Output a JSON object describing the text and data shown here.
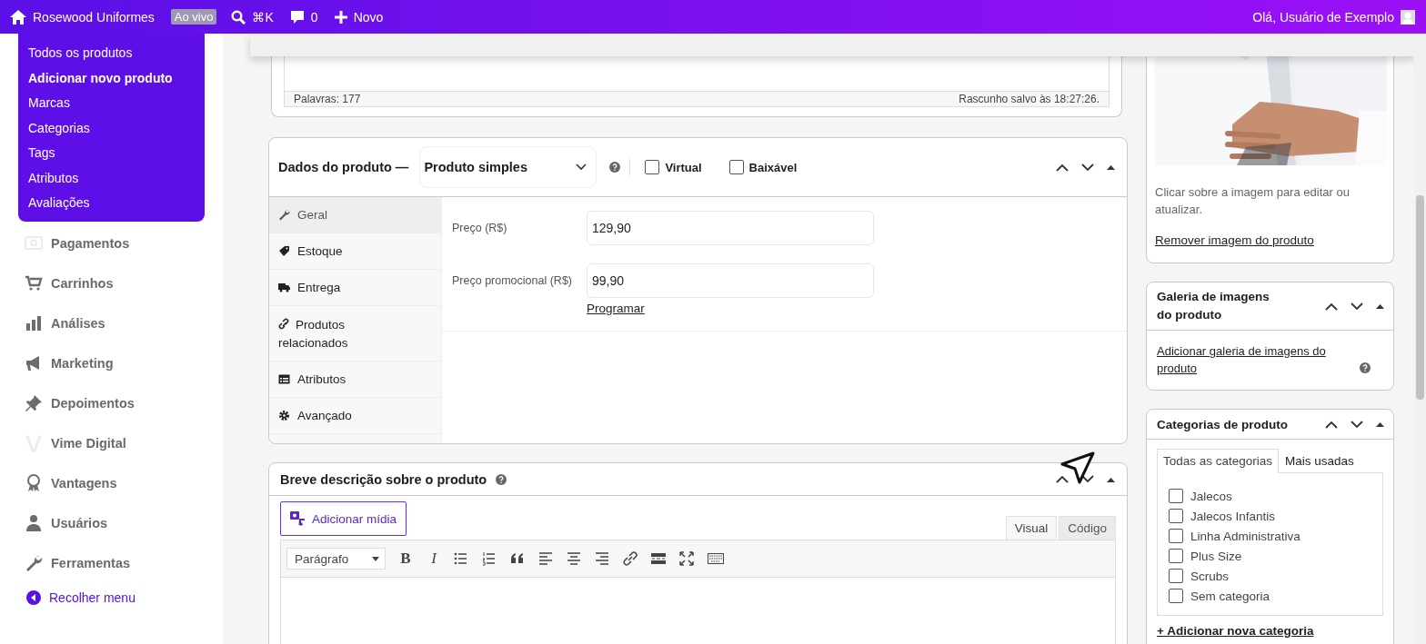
{
  "topbar": {
    "site_name": "Rosewood Uniformes",
    "badge": "Ao vivo",
    "search_shortcut": "⌘K",
    "comments": "0",
    "new_label": "Novo",
    "greeting": "Olá, Usuário de Exemplo"
  },
  "sidebar": {
    "submenu": [
      {
        "label": "Todos os produtos",
        "selected": false
      },
      {
        "label": "Adicionar novo produto",
        "selected": true
      },
      {
        "label": "Marcas",
        "selected": false
      },
      {
        "label": "Categorias",
        "selected": false
      },
      {
        "label": "Tags",
        "selected": false
      },
      {
        "label": "Atributos",
        "selected": false
      },
      {
        "label": "Avaliações",
        "selected": false
      }
    ],
    "items": [
      {
        "label": "Pagamentos"
      },
      {
        "label": "Carrinhos"
      },
      {
        "label": "Análises"
      },
      {
        "label": "Marketing"
      },
      {
        "label": "Depoimentos"
      },
      {
        "label": "Vime Digital"
      },
      {
        "label": "Vantagens"
      },
      {
        "label": "Usuários"
      },
      {
        "label": "Ferramentas"
      }
    ],
    "collapse": "Recolher menu"
  },
  "editor": {
    "word_count": "Palavras: 177",
    "draft_status": "Rascunho salvo às 18:27:26."
  },
  "product_data": {
    "title": "Dados do produto —",
    "type_select": "Produto simples",
    "options": [
      {
        "label": "Virtual",
        "checked": false
      },
      {
        "label": "Baixável",
        "checked": false
      }
    ],
    "tabs": [
      {
        "label": "Geral",
        "selected": true
      },
      {
        "label": "Estoque",
        "selected": false
      },
      {
        "label": "Entrega",
        "selected": false
      },
      {
        "label": "Produtos relacionados",
        "selected": false
      },
      {
        "label": "Atributos",
        "selected": false
      },
      {
        "label": "Avançado",
        "selected": false
      }
    ],
    "fields": [
      {
        "label": "Preço (R$)",
        "value": "129,90"
      },
      {
        "label": "Preço promocional (R$)",
        "value": "99,90"
      }
    ],
    "schedule_link": "Programar"
  },
  "short_description": {
    "title": "Breve descrição sobre o produto",
    "add_media": "Adicionar mídia",
    "editor_tabs": [
      {
        "label": "Visual",
        "selected": true
      },
      {
        "label": "Código",
        "selected": false
      }
    ],
    "format_select": "Parágrafo",
    "toolbar": [
      {
        "kind": "bold",
        "label": "B"
      },
      {
        "kind": "italic",
        "label": "I"
      },
      {
        "kind": "bullet-list"
      },
      {
        "kind": "numbered-list"
      },
      {
        "kind": "quote"
      },
      {
        "kind": "align-left"
      },
      {
        "kind": "align-center"
      },
      {
        "kind": "align-right"
      },
      {
        "kind": "link"
      },
      {
        "kind": "more"
      },
      {
        "kind": "fullscreen"
      },
      {
        "kind": "keyboard"
      }
    ]
  },
  "product_image": {
    "kind": "picture",
    "hint": "Clicar sobre a imagem para editar ou atualizar.",
    "remove_link": "Remover imagem do produto"
  },
  "gallery": {
    "title": "Galeria de imagens do produto",
    "link": "Adicionar galeria de imagens do produto"
  },
  "categories": {
    "title": "Categorias de produto",
    "tabs": [
      {
        "label": "Todas as categorias",
        "selected": true
      },
      {
        "label": "Mais usadas",
        "selected": false
      }
    ],
    "items": [
      {
        "label": "Jalecos",
        "checked": false
      },
      {
        "label": "Jalecos Infantis",
        "checked": false
      },
      {
        "label": "Linha Administrativa",
        "checked": false
      },
      {
        "label": "Plus Size",
        "checked": false
      },
      {
        "label": "Scrubs",
        "checked": false
      },
      {
        "label": "Sem categoria",
        "checked": false
      }
    ],
    "add_link": "+ Adicionar nova categoria"
  }
}
